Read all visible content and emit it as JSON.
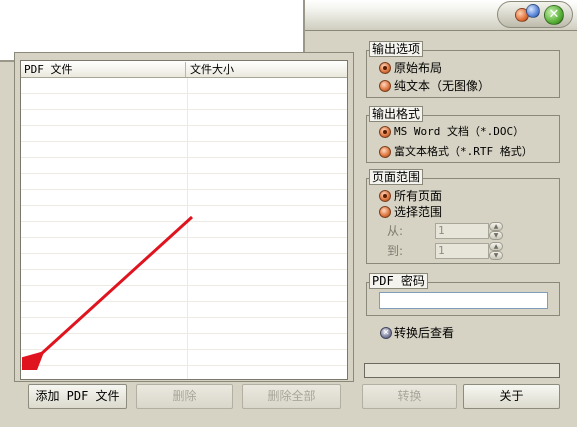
{
  "file_list": {
    "columns": [
      "PDF 文件",
      "文件大小"
    ],
    "rows": []
  },
  "buttons": {
    "add_pdf": "添加 PDF 文件",
    "delete": "删除",
    "delete_all": "删除全部",
    "convert": "转换",
    "about": "关于"
  },
  "output_options": {
    "title": "输出选项",
    "options": [
      "原始布局",
      "纯文本（无图像）"
    ],
    "selected": 0
  },
  "output_format": {
    "title": "输出格式",
    "options": [
      "MS Word 文档（*.DOC）",
      "富文本格式（*.RTF 格式）"
    ],
    "selected": 0
  },
  "page_range": {
    "title": "页面范围",
    "options": [
      "所有页面",
      "选择范围"
    ],
    "selected": 0,
    "from_label": "从:",
    "from_value": "1",
    "to_label": "到:",
    "to_value": "1"
  },
  "pdf_password": {
    "title": "PDF 密码",
    "value": ""
  },
  "view_after_convert": {
    "label": "转换后查看",
    "checked": true
  },
  "colors": {
    "window_bg": "#d6d3c4",
    "radio_accent": "#e07a45",
    "arrow": "#e0141e",
    "close_button": "#58b038"
  },
  "icons": {
    "close": "close-icon",
    "window_orbs": [
      "minimize-orb-icon",
      "maximize-orb-icon"
    ],
    "annotation": "red-arrow-icon"
  }
}
